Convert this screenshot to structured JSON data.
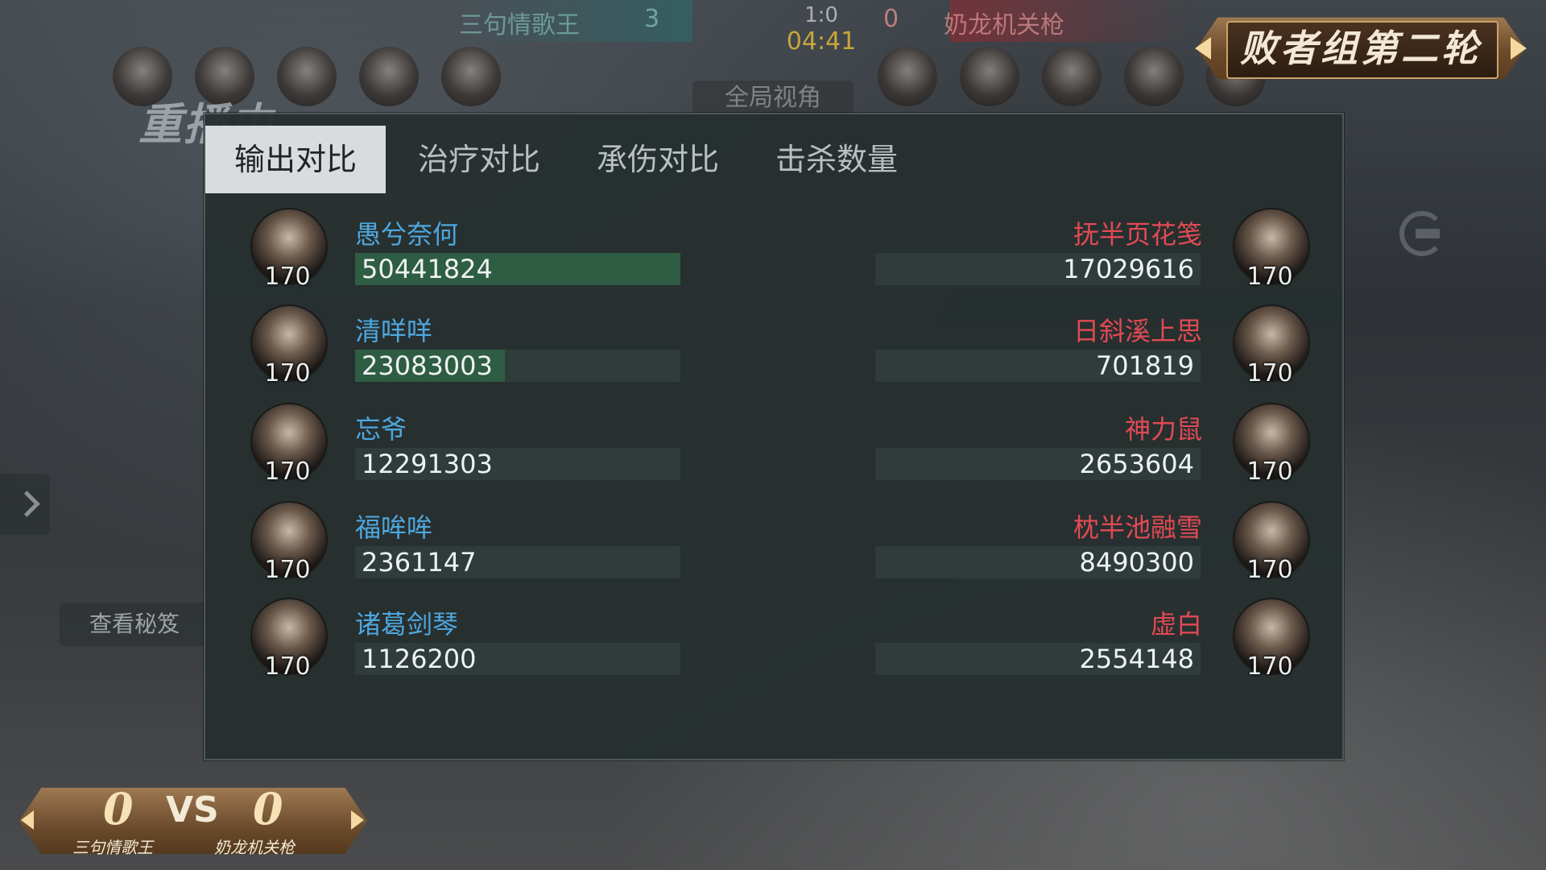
{
  "scoreboard": {
    "team_left": "三句情歌王",
    "team_right": "奶龙机关枪",
    "score_left": "3",
    "score_right": "0",
    "round_score": "1:0",
    "timer": "04:41",
    "global_view": "全局视角"
  },
  "round_banner": "败者组第二轮",
  "replay_label": "重播中",
  "side": {
    "view_secrets": "查看秘笈"
  },
  "tabs": [
    {
      "label": "输出对比",
      "active": true
    },
    {
      "label": "治疗对比",
      "active": false
    },
    {
      "label": "承伤对比",
      "active": false
    },
    {
      "label": "击杀数量",
      "active": false
    }
  ],
  "rows": [
    {
      "left": {
        "name": "愚兮奈何",
        "value": "50441824",
        "level": "170",
        "fill": 1.0
      },
      "right": {
        "name": "抚半页花笺",
        "value": "17029616",
        "level": "170",
        "fill": 0.0
      }
    },
    {
      "left": {
        "name": "清咩咩",
        "value": "23083003",
        "level": "170",
        "fill": 0.46
      },
      "right": {
        "name": "日斜溪上思",
        "value": "701819",
        "level": "170",
        "fill": 0.0
      }
    },
    {
      "left": {
        "name": "忘爷",
        "value": "12291303",
        "level": "170",
        "fill": 0.0
      },
      "right": {
        "name": "神力鼠",
        "value": "2653604",
        "level": "170",
        "fill": 0.0
      }
    },
    {
      "left": {
        "name": "福哞哞",
        "value": "2361147",
        "level": "170",
        "fill": 0.0
      },
      "right": {
        "name": "枕半池融雪",
        "value": "8490300",
        "level": "170",
        "fill": 0.0
      }
    },
    {
      "left": {
        "name": "诸葛剑琴",
        "value": "1126200",
        "level": "170",
        "fill": 0.0
      },
      "right": {
        "name": "虚白",
        "value": "2554148",
        "level": "170",
        "fill": 0.0
      }
    }
  ],
  "match_score": {
    "left_score": "0",
    "vs": "VS",
    "right_score": "0",
    "left_team": "三句情歌王",
    "right_team": "奶龙机关枪"
  },
  "colors": {
    "team_left": "#4ea7de",
    "team_right": "#e14a55",
    "bar_fill": "#2e5d44",
    "panel_bg": "#262f2f"
  }
}
